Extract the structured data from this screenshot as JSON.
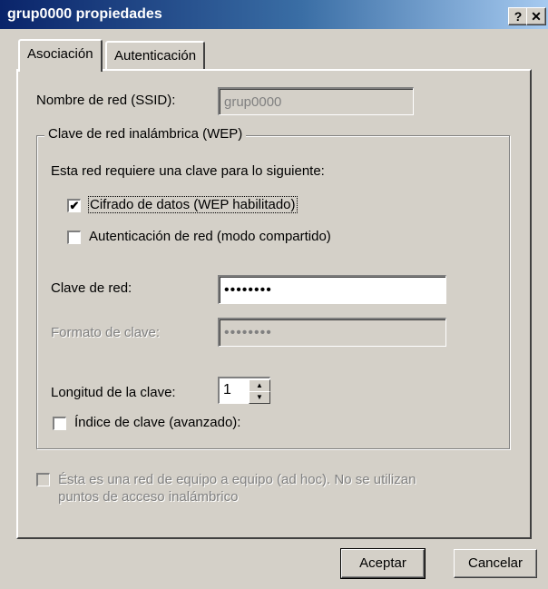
{
  "window": {
    "title": "grup0000 propiedades",
    "help_label": "?",
    "close_label": "✕"
  },
  "tabs": [
    {
      "label": "Asociación"
    },
    {
      "label": "Autenticación"
    }
  ],
  "association": {
    "ssid_label": "Nombre de red (SSID):",
    "ssid_value": "grup0000",
    "wep_group_title": "Clave de red inalámbrica (WEP)",
    "requires_text": "Esta red requiere una clave para lo siguiente:",
    "data_encryption": {
      "label": "Cifrado de datos (WEP habilitado)",
      "checked": true
    },
    "network_auth": {
      "label": "Autenticación de red (modo compartido)",
      "checked": false
    },
    "network_key_label": "Clave de red:",
    "network_key_value": "••••••••",
    "key_format_label": "Formato de clave:",
    "key_format_value": "••••••••",
    "key_length_label": "Longitud de la clave:",
    "key_length_value": "1",
    "key_index": {
      "label": "Índice de clave (avanzado):",
      "checked": false
    },
    "adhoc": {
      "label": "Ésta es una red de equipo a equipo (ad hoc). No se utilizan puntos de acceso inalámbrico",
      "checked": false
    }
  },
  "buttons": {
    "ok_label": "Aceptar",
    "cancel_label": "Cancelar"
  },
  "colors": {
    "title_bar_start": "#0a246a",
    "title_bar_end": "#a6caf0",
    "dialog_bg": "#d4d0c8"
  }
}
